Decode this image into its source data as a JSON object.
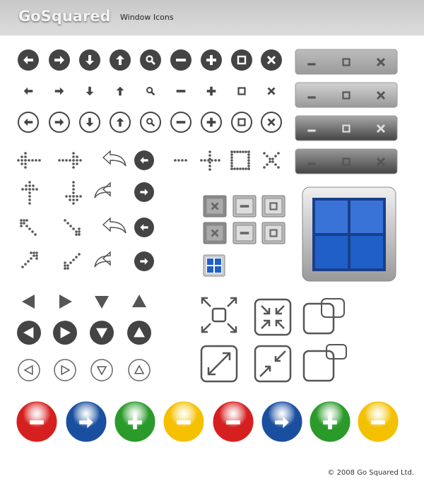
{
  "header": {
    "logo": "GoSquared",
    "subtitle": "Window Icons"
  },
  "footer": {
    "copyright": "© 2008 Go Squared Ltd."
  },
  "colors": {
    "dark": "#444444",
    "red": "#d62020",
    "blue": "#1a4fa0",
    "green": "#2a9a2a",
    "yellow": "#f5c000",
    "window_blue": "#1f5fc8"
  },
  "icon_rows": [
    "arrow-left",
    "arrow-right",
    "arrow-down",
    "arrow-up",
    "search",
    "minus",
    "plus",
    "square",
    "close"
  ],
  "colored_buttons": [
    {
      "icon": "minus",
      "color": "#d62020"
    },
    {
      "icon": "arrow-right",
      "color": "#1a4fa0"
    },
    {
      "icon": "plus",
      "color": "#2a9a2a"
    },
    {
      "icon": "minus",
      "color": "#f5c000"
    },
    {
      "icon": "minus",
      "color": "#d62020"
    },
    {
      "icon": "arrow-right",
      "color": "#1a4fa0"
    },
    {
      "icon": "plus",
      "color": "#2a9a2a"
    },
    {
      "icon": "minus",
      "color": "#f5c000"
    }
  ]
}
